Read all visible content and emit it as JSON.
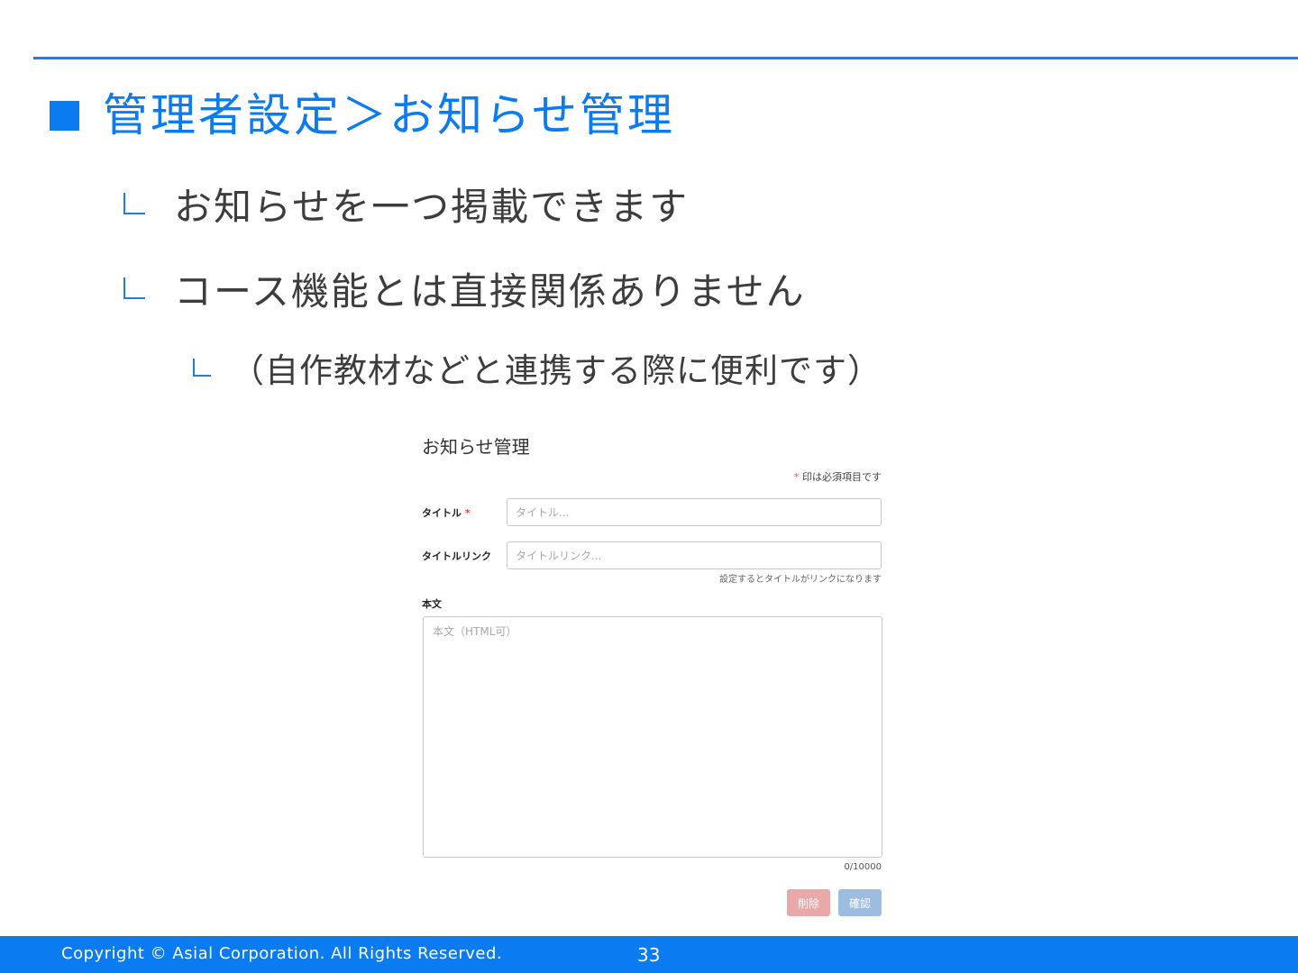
{
  "slide": {
    "title": "管理者設定＞お知らせ管理",
    "bullets": [
      "お知らせを一つ掲載できます",
      "コース機能とは直接関係ありません",
      "（自作教材などと連携する際に便利です）"
    ]
  },
  "form": {
    "heading": "お知らせ管理",
    "required_star": "*",
    "required_note": "印は必須項目です",
    "title_label": "タイトル",
    "title_placeholder": "タイトル...",
    "link_label": "タイトルリンク",
    "link_placeholder": "タイトルリンク...",
    "link_help": "設定するとタイトルがリンクになります",
    "body_label": "本文",
    "body_placeholder": "本文（HTML可）",
    "char_count": "0/10000",
    "delete_label": "削除",
    "confirm_label": "確認"
  },
  "footer": {
    "copyright": "Copyright ©  Asial Corporation. All Rights Reserved.",
    "page_number": "33"
  },
  "colors": {
    "accent": "#0a7bf0",
    "delete_button": "#e8a9a8",
    "confirm_button": "#9dbde0",
    "required_star": "#d9534f"
  },
  "icons": {
    "title_marker": "blue-square-icon",
    "bullet_marker": "corner-bracket-icon"
  }
}
